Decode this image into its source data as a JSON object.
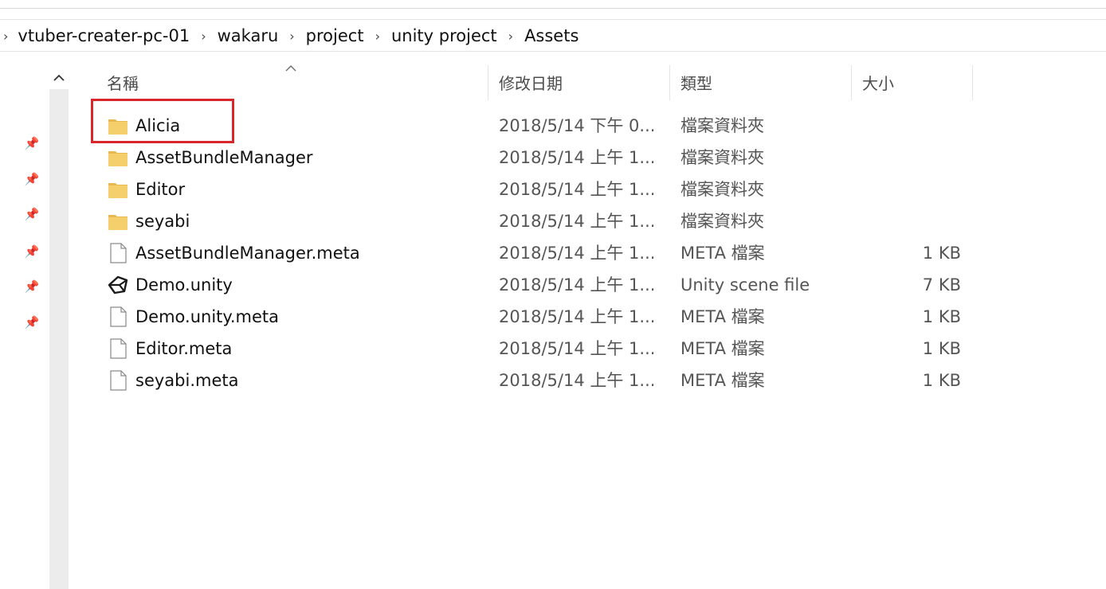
{
  "breadcrumb": [
    "vtuber-creater-pc-01",
    "wakaru",
    "project",
    "unity project",
    "Assets"
  ],
  "columns": {
    "name": "名稱",
    "modified": "修改日期",
    "type": "類型",
    "size": "大小"
  },
  "files": [
    {
      "name": "Alicia",
      "date": "2018/5/14 下午 0...",
      "type": "檔案資料夾",
      "size": "",
      "icon": "folder-icon"
    },
    {
      "name": "AssetBundleManager",
      "date": "2018/5/14 上午 1...",
      "type": "檔案資料夾",
      "size": "",
      "icon": "folder-icon"
    },
    {
      "name": "Editor",
      "date": "2018/5/14 上午 1...",
      "type": "檔案資料夾",
      "size": "",
      "icon": "folder-icon"
    },
    {
      "name": "seyabi",
      "date": "2018/5/14 上午 1...",
      "type": "檔案資料夾",
      "size": "",
      "icon": "folder-icon"
    },
    {
      "name": "AssetBundleManager.meta",
      "date": "2018/5/14 上午 1...",
      "type": "META 檔案",
      "size": "1 KB",
      "icon": "file-icon"
    },
    {
      "name": "Demo.unity",
      "date": "2018/5/14 上午 1...",
      "type": "Unity scene file",
      "size": "7 KB",
      "icon": "unity-icon"
    },
    {
      "name": "Demo.unity.meta",
      "date": "2018/5/14 上午 1...",
      "type": "META 檔案",
      "size": "1 KB",
      "icon": "file-icon"
    },
    {
      "name": "Editor.meta",
      "date": "2018/5/14 上午 1...",
      "type": "META 檔案",
      "size": "1 KB",
      "icon": "file-icon"
    },
    {
      "name": "seyabi.meta",
      "date": "2018/5/14 上午 1...",
      "type": "META 檔案",
      "size": "1 KB",
      "icon": "file-icon"
    }
  ],
  "colors": {
    "highlight_border": "#d9262b",
    "folder": "#f5cf6b"
  }
}
